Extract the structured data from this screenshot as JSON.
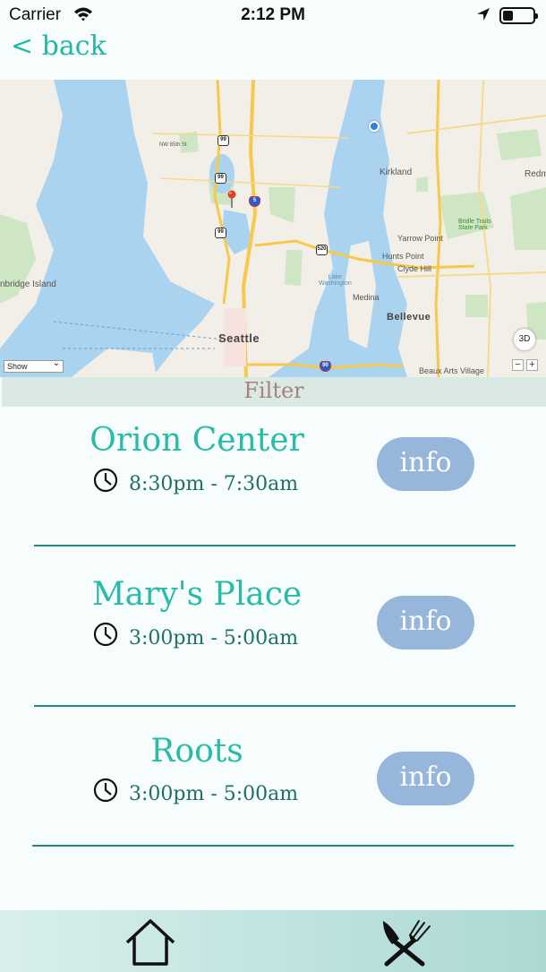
{
  "status_bar": {
    "carrier": "Carrier",
    "time": "2:12 PM"
  },
  "nav": {
    "back_label": "< back"
  },
  "map": {
    "labels": {
      "kirkland": "Kirkland",
      "redmond": "Redm",
      "yarrow_point": "Yarrow Point",
      "hunts_point": "Hunts Point",
      "clyde_hill": "Clyde Hill",
      "medina": "Medina",
      "bellevue": "Bellevue",
      "seattle": "Seattle",
      "bainbridge": "nbridge Island",
      "beaux_arts": "Beaux Arts Village",
      "lake_washington": "Lake\nWashington",
      "bridle_trails": "Bridle Trails\nState Park",
      "nw_85th": "NW 85th St"
    },
    "highway_shields": [
      "99",
      "99",
      "99",
      "5",
      "520",
      "90"
    ],
    "show_select": "Show",
    "btn_3d": "3D",
    "zoom_out": "−",
    "zoom_in": "+"
  },
  "filter": {
    "label": "Filter"
  },
  "places": [
    {
      "name": "Orion Center",
      "hours": "8:30pm - 7:30am",
      "info_label": "info"
    },
    {
      "name": "Mary's Place",
      "hours": "3:00pm - 5:00am",
      "info_label": "info"
    },
    {
      "name": "Roots",
      "hours": "3:00pm - 5:00am",
      "info_label": "info"
    }
  ],
  "tab_bar": {
    "tabs": [
      {
        "icon": "home-icon"
      },
      {
        "icon": "fork-knife-icon"
      }
    ]
  },
  "colors": {
    "accent": "#27bba8",
    "info_button": "#96b6dc",
    "divider": "#1f8b83",
    "filter_bg": "#dbe9e4",
    "filter_text": "#a8827f"
  }
}
